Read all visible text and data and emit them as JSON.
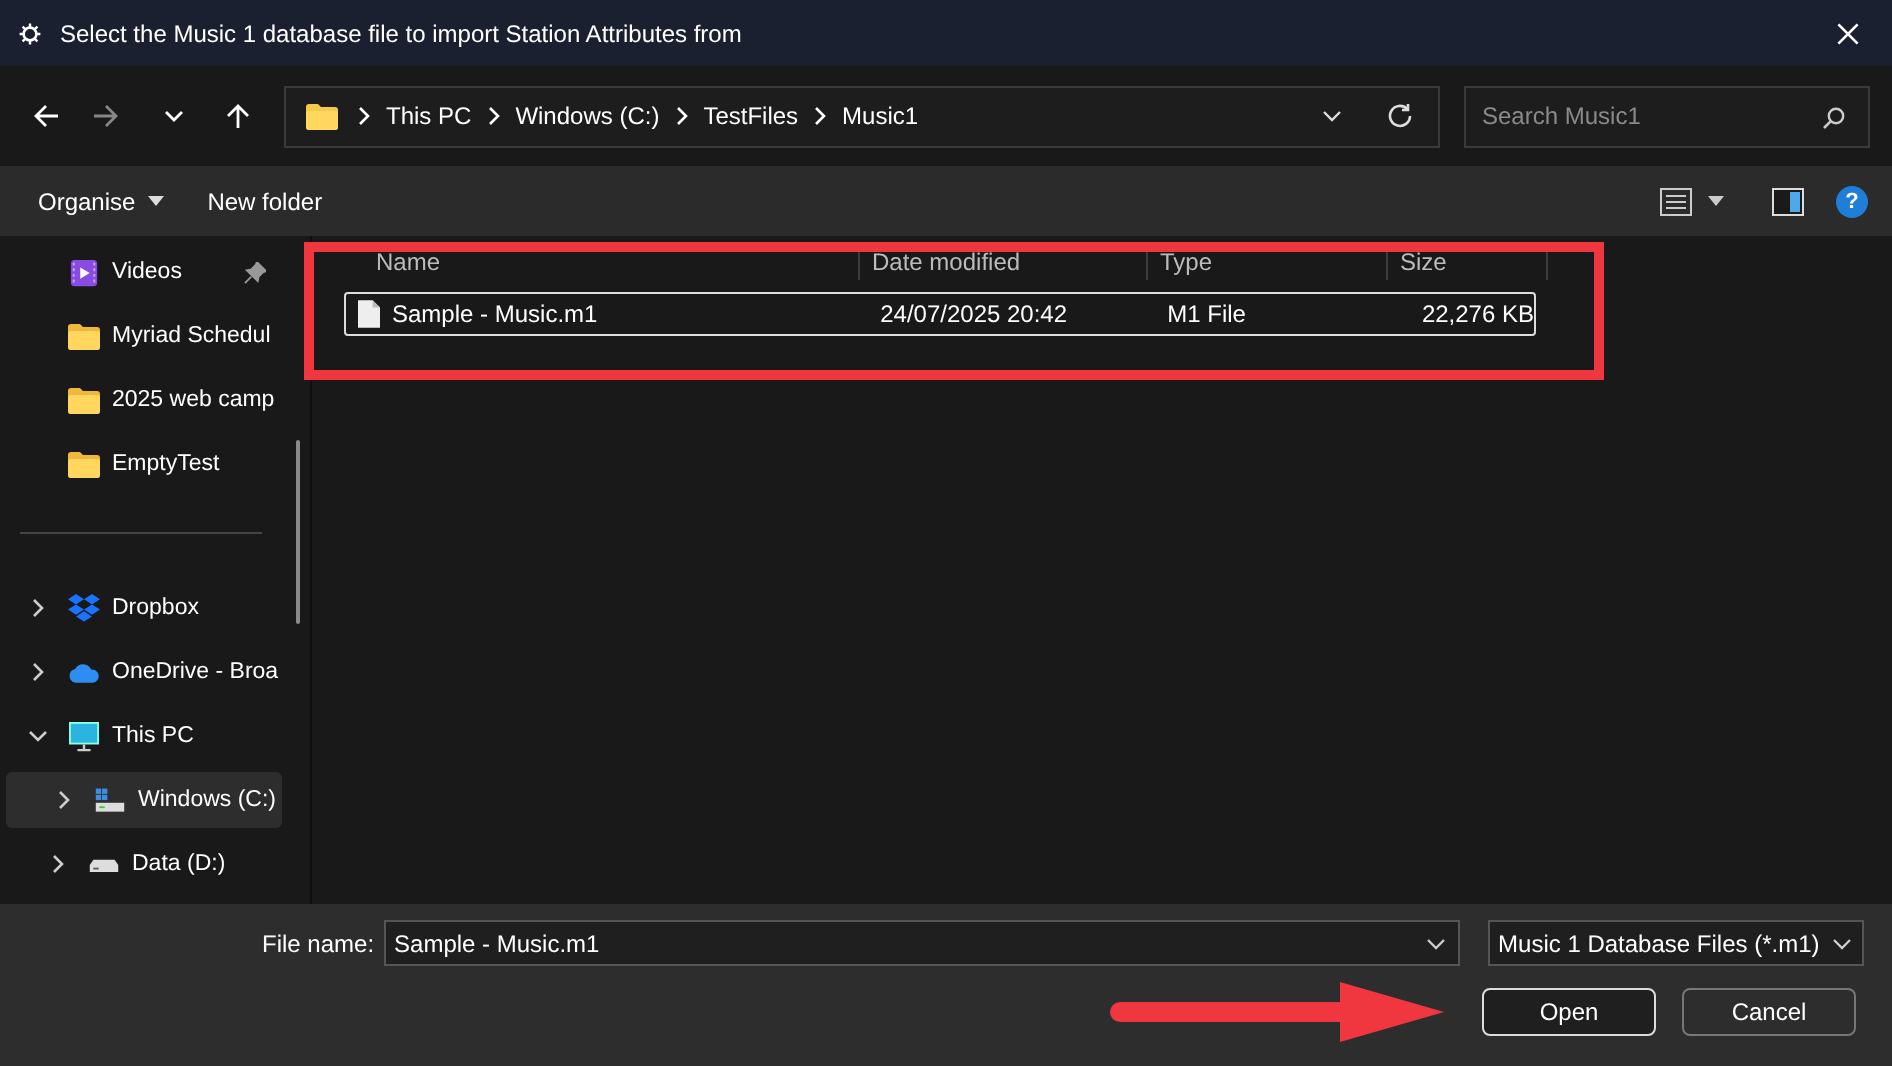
{
  "window": {
    "title": "Select the Music 1 database file to import Station Attributes from"
  },
  "address_bar": {
    "segments": [
      "This PC",
      "Windows (C:)",
      "TestFiles",
      "Music1"
    ]
  },
  "search": {
    "placeholder": "Search Music1"
  },
  "toolbar": {
    "organise": "Organise",
    "new_folder": "New folder",
    "help": "?"
  },
  "sidebar": {
    "items": [
      {
        "label": "Videos",
        "kind": "video",
        "pinned": true
      },
      {
        "label": "Myriad Schedul",
        "kind": "folder",
        "pinned": false
      },
      {
        "label": "2025 web camp",
        "kind": "folder",
        "pinned": false
      },
      {
        "label": "EmptyTest",
        "kind": "folder",
        "pinned": false
      },
      {
        "kind": "divider"
      },
      {
        "label": "Dropbox",
        "kind": "dropbox",
        "expanded": false,
        "selected": false
      },
      {
        "label": "OneDrive - Broa",
        "kind": "cloud",
        "expanded": false,
        "selected": false
      },
      {
        "label": "This PC",
        "kind": "pc",
        "expanded": true,
        "selected": false,
        "children": [
          {
            "label": "Windows (C:)",
            "kind": "drive-windows",
            "expanded": false,
            "selected": true
          },
          {
            "label": "Data (D:)",
            "kind": "drive",
            "expanded": false,
            "selected": false
          }
        ]
      }
    ]
  },
  "table": {
    "columns": [
      "Name",
      "Date modified",
      "Type",
      "Size"
    ],
    "rows": [
      {
        "name": "Sample - Music.m1",
        "date": "24/07/2025 20:42",
        "type": "M1 File",
        "size": "22,276 KB",
        "selected": true
      }
    ]
  },
  "footer": {
    "file_name_label": "File name:",
    "file_name": "Sample - Music.m1",
    "filter": "Music 1 Database Files (*.m1)",
    "buttons": [
      {
        "label": "Open",
        "default": true
      },
      {
        "label": "Cancel",
        "default": false
      }
    ]
  }
}
